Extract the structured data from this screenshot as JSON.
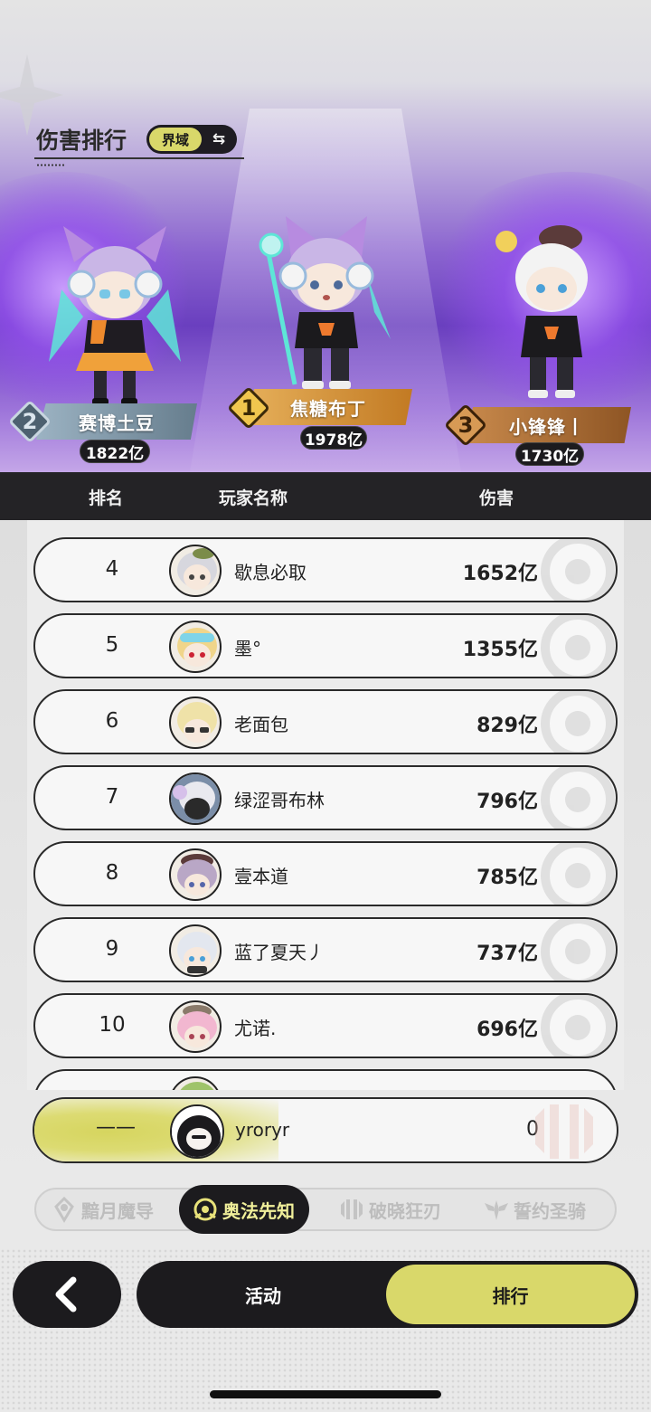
{
  "header": {
    "title": "伤害排行",
    "realm_label": "界域",
    "swap_icon": "swap-arrows-icon"
  },
  "podium": [
    {
      "rank": "2",
      "name": "赛博土豆",
      "damage": "1822亿"
    },
    {
      "rank": "1",
      "name": "焦糖布丁",
      "damage": "1978亿"
    },
    {
      "rank": "3",
      "name": "小锋锋丨",
      "damage": "1730亿"
    }
  ],
  "table": {
    "columns": [
      "排名",
      "玩家名称",
      "伤害"
    ],
    "rows": [
      {
        "rank": "4",
        "name": "歇息必取",
        "damage": "1652亿"
      },
      {
        "rank": "5",
        "name": "墨°",
        "damage": "1355亿"
      },
      {
        "rank": "6",
        "name": "老面包",
        "damage": "829亿"
      },
      {
        "rank": "7",
        "name": "绿涩哥布林",
        "damage": "796亿"
      },
      {
        "rank": "8",
        "name": "壹本道",
        "damage": "785亿"
      },
      {
        "rank": "9",
        "name": "蓝了夏天丿",
        "damage": "737亿"
      },
      {
        "rank": "10",
        "name": "尤诺.",
        "damage": "696亿"
      }
    ]
  },
  "me": {
    "rank": "——",
    "name": "yroryr",
    "damage": "0"
  },
  "class_tabs": [
    {
      "label": "黯月魔导",
      "icon": "moon-crest-icon",
      "active": false
    },
    {
      "label": "奥法先知",
      "icon": "arcane-crest-icon",
      "active": true
    },
    {
      "label": "破晓狂刃",
      "icon": "blade-crest-icon",
      "active": false
    },
    {
      "label": "誓约圣骑",
      "icon": "wing-crest-icon",
      "active": false
    }
  ],
  "nav": {
    "back_icon": "chevron-left-icon",
    "activity_label": "活动",
    "ranking_label": "排行"
  },
  "colors": {
    "accent": "#d9d86a",
    "dark": "#1c1b1e",
    "gold": "#e6b05b",
    "silver": "#9cb3c3",
    "bronze": "#c98a4c"
  }
}
